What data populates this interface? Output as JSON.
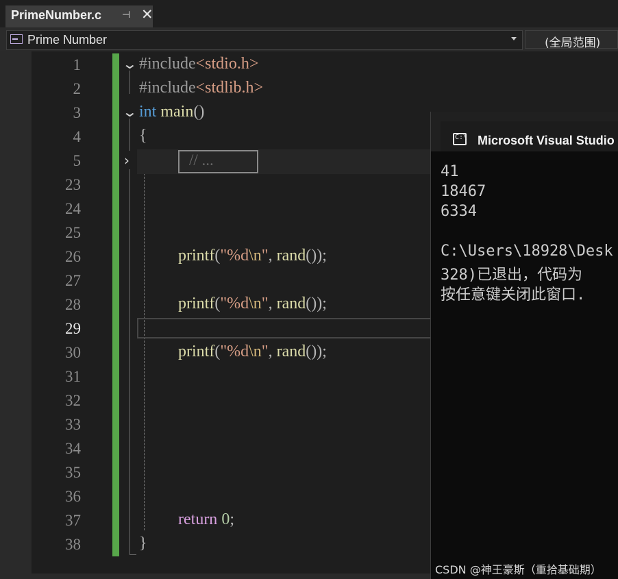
{
  "tab": {
    "title": "PrimeNumber.c",
    "pin": "⊣",
    "close": "✕"
  },
  "navbar": {
    "class_combo": "Prime Number",
    "scope": "(全局范围)"
  },
  "gutter": {
    "lines": [
      "1",
      "2",
      "3",
      "4",
      "5",
      "23",
      "24",
      "25",
      "26",
      "27",
      "28",
      "29",
      "30",
      "31",
      "32",
      "33",
      "34",
      "35",
      "36",
      "37",
      "38"
    ],
    "active_line": "29"
  },
  "code": {
    "l1": {
      "directive": "#include",
      "header": "<stdio.h>"
    },
    "l2": {
      "directive": "#include",
      "header": "<stdlib.h>"
    },
    "l3": {
      "type": "int",
      "name": "main",
      "parens": "()"
    },
    "l4": {
      "brace": "{"
    },
    "l5": {
      "collapsed": "// ..."
    },
    "printf": {
      "fn": "printf",
      "open": "(",
      "q1": "\"",
      "fmt": "%d",
      "esc": "\\n",
      "q2": "\"",
      "sep": ", ",
      "call": "rand",
      "close": "());"
    },
    "l37": {
      "kw": "return",
      "val": "0",
      "semi": ";"
    },
    "l38": {
      "brace": "}"
    }
  },
  "console": {
    "title": "Microsoft Visual Studio 调",
    "icon": "C:\\",
    "lines": [
      "41",
      "18467",
      "6334",
      "",
      "C:\\Users\\18928\\Desk",
      "328)已退出，代码为",
      "按任意键关闭此窗口."
    ],
    "watermark": "CSDN @神王豪斯（重拾基础期）"
  }
}
